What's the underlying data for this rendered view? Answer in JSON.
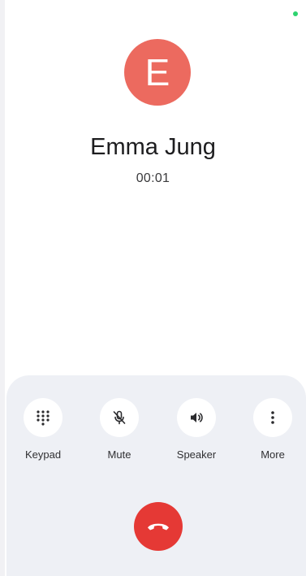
{
  "contact": {
    "initial": "E",
    "name": "Emma Jung",
    "avatar_color": "#ec6a5f"
  },
  "call": {
    "timer": "00:01"
  },
  "controls": [
    {
      "label": "Keypad",
      "icon": "dialpad-icon"
    },
    {
      "label": "Mute",
      "icon": "mic-off-icon"
    },
    {
      "label": "Speaker",
      "icon": "speaker-icon"
    },
    {
      "label": "More",
      "icon": "more-vert-icon"
    }
  ],
  "end_call": {
    "icon": "call-end-icon",
    "color": "#e53935"
  },
  "colors": {
    "panel_background": "#eef0f5",
    "status_indicator": "#2dd36f"
  }
}
